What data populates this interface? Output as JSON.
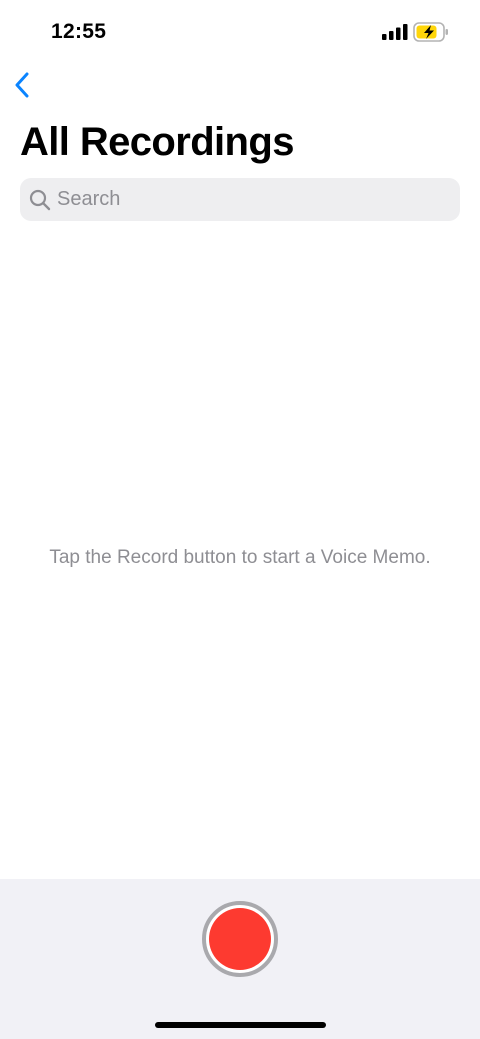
{
  "status_bar": {
    "time": "12:55",
    "signal_icon": "cellular-signal-icon",
    "battery_icon": "battery-charging-icon",
    "battery_color": "#ffd60a"
  },
  "nav": {
    "back_icon": "chevron-left-icon",
    "accent_color": "#0a84ff"
  },
  "title": "All Recordings",
  "search": {
    "icon": "search-icon",
    "placeholder": "Search",
    "value": ""
  },
  "empty_state": {
    "message": "Tap the Record button to start a Voice Memo."
  },
  "record": {
    "icon": "record-icon",
    "color": "#fd3a30"
  }
}
